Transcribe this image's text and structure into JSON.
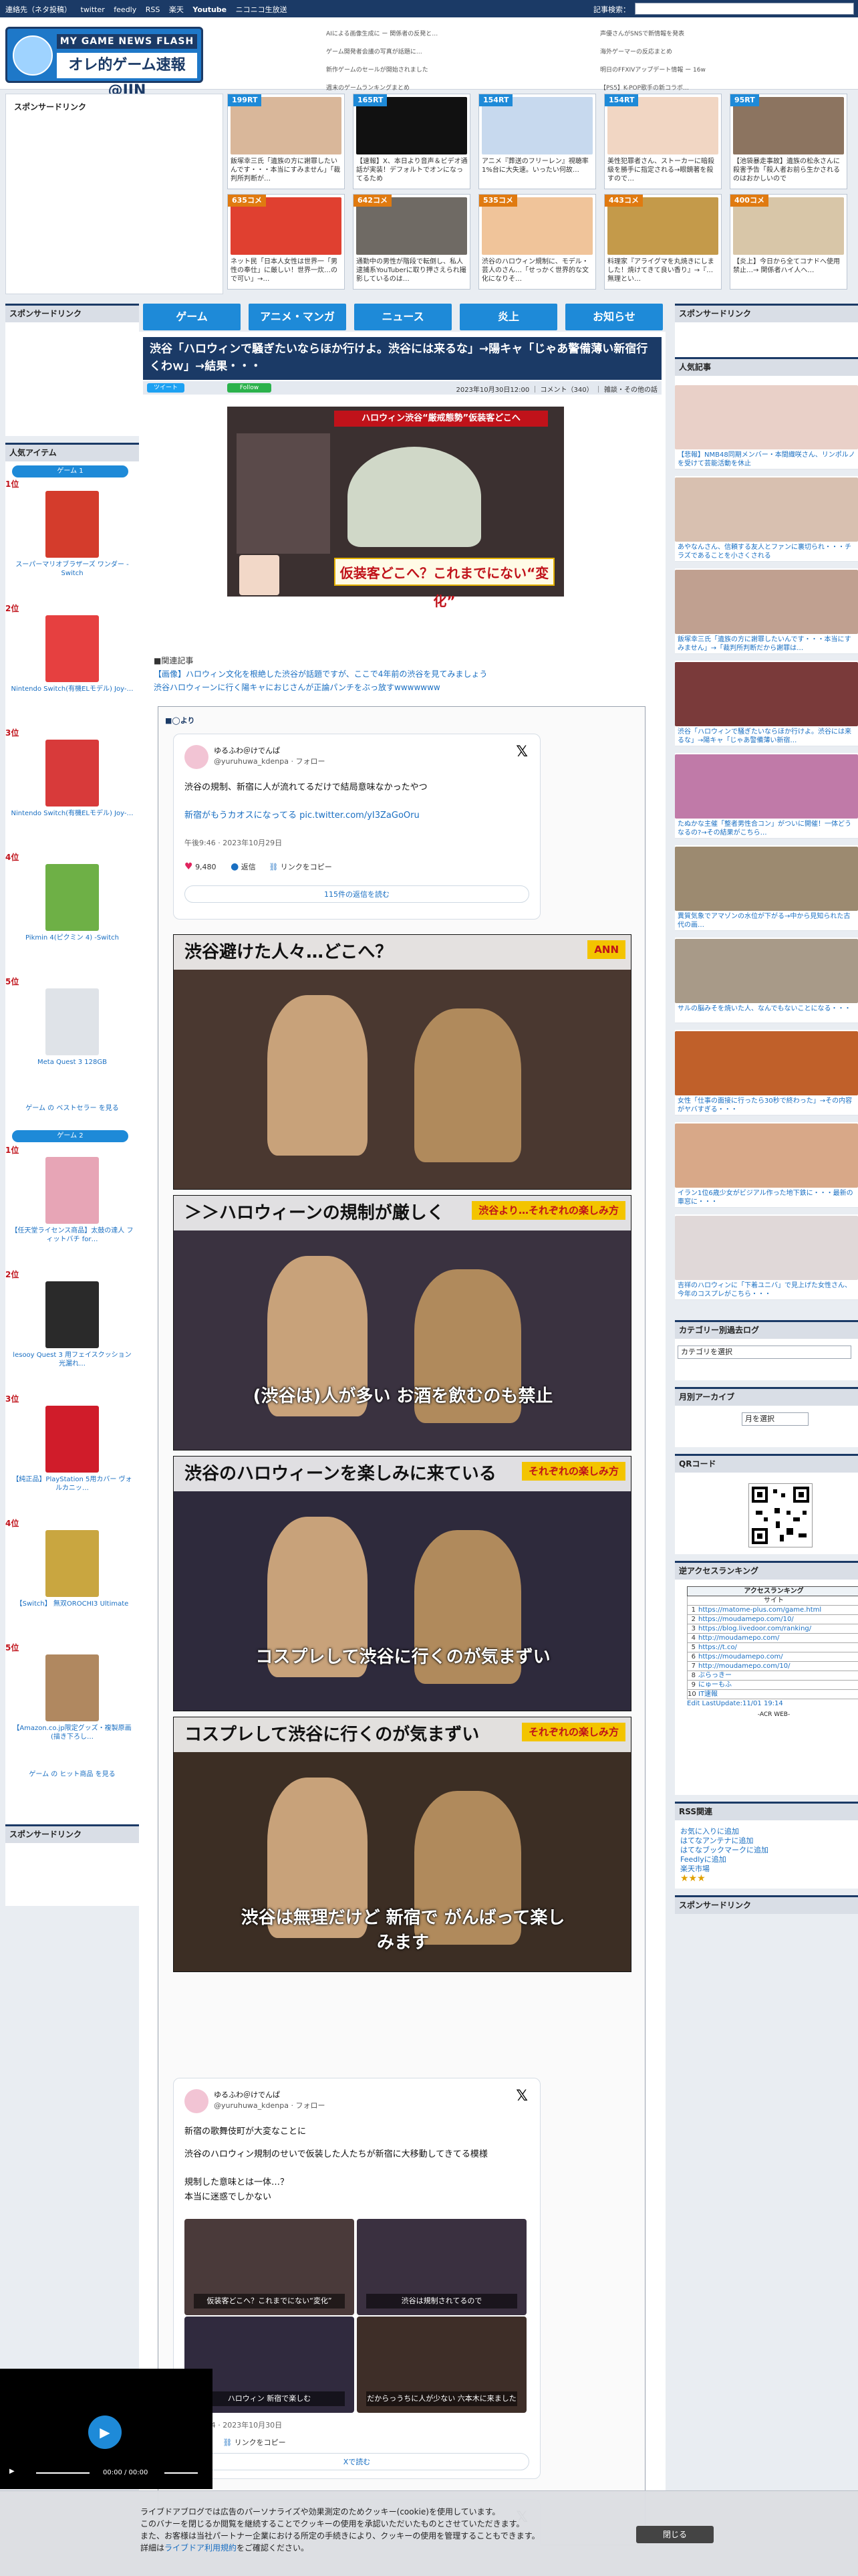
{
  "topbar": {
    "links": [
      "連絡先（ネタ投稿）",
      "twitter",
      "feedly",
      "RSS",
      "楽天",
      "Youtube",
      "ニコニコ生放送"
    ],
    "search_label": "記事検索："
  },
  "logo": {
    "top": "MY GAME NEWS FLASH",
    "main": "オレ的ゲーム速報@JIN"
  },
  "header_links_a": [
    "AIによる画像生成に ー 関係者の反発と…",
    "ゲーム開発者会議の写真が話題に…",
    "新作ゲームのセールが開始されました",
    "週末のゲームランキングまとめ"
  ],
  "header_links_b": [
    "声優さんがSNSで新情報を発表",
    "海外ゲーマーの反応まとめ",
    "明日のFFXIVアップデート情報 ー 16w",
    "【PS5】K-POP歌手の新コラボ…"
  ],
  "sponsor_label": "スポンサードリンク",
  "banners": [
    {
      "badge": "199RT",
      "badge_color": "#1e8ad8",
      "thumb": "#d9b79a",
      "caption": "飯塚幸三氏「遺族の方に謝罪したいんです・・・本当にすみません」「裁判所判断が…"
    },
    {
      "badge": "165RT",
      "badge_color": "#1e8ad8",
      "thumb": "#111111",
      "caption": "【速報】X、本日より音声＆ビデオ通話が実装！デフォルトでオンになってるため"
    },
    {
      "badge": "154RT",
      "badge_color": "#1e8ad8",
      "thumb": "#c7d9ee",
      "caption": "アニメ『葬送のフリーレン』視聴率1%台に大失速。いったい何故…"
    },
    {
      "badge": "154RT",
      "badge_color": "#1e8ad8",
      "thumb": "#f1d6c3",
      "caption": "美性犯罪者さん、ストーカーに暗殺級を勝手に指定される→眼鏡著を殺すので…"
    },
    {
      "badge": "95RT",
      "badge_color": "#1e8ad8",
      "thumb": "#8c7460",
      "caption": "【池袋暴走事故】遺族の松永さんに殺害予告「殺人者お前ら生かされるのはおかしいので"
    },
    {
      "badge": "635コメ",
      "badge_color": "#e07a10",
      "thumb": "#e04030",
      "caption": "ネット民「日本人女性は世界一「男性の奉仕」に厳しい！世界一炊…ので可い」→…"
    },
    {
      "badge": "642コメ",
      "badge_color": "#e07a10",
      "thumb": "#6f6a64",
      "caption": "通勤中の男性が階段で転倒し、私人逮捕系YouTuberに取り押さえられ撮影しているのは…"
    },
    {
      "badge": "535コメ",
      "badge_color": "#e07a10",
      "thumb": "#f0c49a",
      "caption": "渋谷のハロウィン規制に、モデル・芸人のさん…「せっかく世界的な文化になりそ…"
    },
    {
      "badge": "443コメ",
      "badge_color": "#e07a10",
      "thumb": "#c49a4a",
      "caption": "料理家『アライグマを丸焼きにしました！焼けてきて良い香り』→『…無理とい…"
    },
    {
      "badge": "400コメ",
      "badge_color": "#e07a10",
      "thumb": "#d8c6a8",
      "caption": "【炎上】今日から全てコナドへ使用禁止…→ 関係者ハイ人へ…"
    }
  ],
  "nav": [
    "ゲーム",
    "アニメ・マンガ",
    "ニュース",
    "炎上",
    "お知らせ"
  ],
  "article": {
    "title": "渋谷「ハロウィンで騒ぎたいならほか行けよ。渋谷には来るな」→陽キャ「じゃあ警備薄い新宿行くわｗ」→結果・・・",
    "tweet_btn": "ツイート",
    "follow_btn": "Follow",
    "meta": "2023年10月30日12:00 ｜ コメント（340） ｜ 雑談・その他の話",
    "hero_tag": "ハロウィン渋谷“厳戒態勢”仮装客どこへ",
    "hero_caption": "仮装客どこへ？これまでにない“変化”",
    "related_label": "■関連記事",
    "related_links": [
      "【画像】ハロウィン文化を根絶した渋谷が話題ですが、ここで4年前の渋谷を見てみましょう",
      "渋谷ハロウィーンに行く陽キャにおじさんが正論パンチをぶっ放すwwwwwww"
    ],
    "quote_head": "■◯より"
  },
  "tweet1": {
    "uname": "ゆるふわ＠けでんぱ",
    "handle": "@yuruhuwa_kdenpa · フォロー",
    "text1": "渋谷の規制、新宿に人が流れてるだけで結局意味なかったやつ",
    "text2": "新宿がもうカオスになってる pic.twitter.com/yI3ZaGoOru",
    "time": "午後9:46 · 2023年10月29日",
    "likes": "9,480",
    "reply": "返信",
    "copy": "リンクをコピー",
    "more": "115件の返信を読む"
  },
  "photos": [
    {
      "top": "渋谷避けた人々…どこへ？",
      "tag": "ANN",
      "bottom": "",
      "bg": "#4a3830"
    },
    {
      "top": "＞＞ハロウィーンの規制が厳しく",
      "tag": "渋谷より…それぞれの楽しみ方",
      "bottom": "(渋谷は)人が多い お酒を飲むのも禁止",
      "bg": "#3a3240"
    },
    {
      "top": "渋谷のハロウィーンを楽しみに来ている",
      "tag": "それぞれの楽しみ方",
      "bottom": "コスプレして渋谷に行くのが気まずい",
      "bg": "#2e2a3c"
    },
    {
      "top": "コスプレして渋谷に行くのが気まずい",
      "tag": "それぞれの楽しみ方",
      "bottom": "渋谷は無理だけど 新宿で がんばって楽しみます",
      "bg": "#3c2e24"
    }
  ],
  "tweet2": {
    "uname": "ゆるふわ＠けでんぱ",
    "handle": "@yuruhuwa_kdenpa · フォロー",
    "text1": "新宿の歌舞伎町が大変なことに",
    "text2": "渋谷のハロウィン規制のせいで仮装した人たちが新宿に大移動してきてる模様",
    "text3": "規制した意味とは一体…？",
    "text4": "本当に迷惑でしかない",
    "mini_caps": [
      "仮装客どこへ？これまでにない“変化”",
      "渋谷は規制されてるので",
      "ハロウィン 新宿で楽しむ",
      "だからっうちに人が少ない 六本木に来ました"
    ],
    "time": "午後0:54 · 2023年10月30日",
    "reply": "返信",
    "copy": "リンクをコピー",
    "more": "Xで読む"
  },
  "left_col": {
    "popular_title": "人気アイテム",
    "tab1": "ゲーム 1",
    "tab2": "ゲーム 2",
    "items1": [
      {
        "rank": "1位",
        "name": "スーパーマリオブラザーズ ワンダー - Switch",
        "color": "#d43c2c"
      },
      {
        "rank": "2位",
        "name": "Nintendo Switch(有機ELモデル) Joy-…",
        "color": "#e64040"
      },
      {
        "rank": "3位",
        "name": "Nintendo Switch(有機ELモデル) Joy-…",
        "color": "#d83a3a"
      },
      {
        "rank": "4位",
        "name": "Pikmin 4(ピクミン 4) -Switch",
        "color": "#6eb046"
      },
      {
        "rank": "5位",
        "name": "Meta Quest 3 128GB",
        "color": "#dfe3e8"
      }
    ],
    "see1": "ゲーム の ベストセラー を見る",
    "items2": [
      {
        "rank": "1位",
        "name": "【任天堂ライセンス商品】太鼓の達人 フィットバチ for…",
        "color": "#e7a5b6"
      },
      {
        "rank": "2位",
        "name": "lesooy Quest 3 用フェイスクッション 光漏れ…",
        "color": "#2a2a2a"
      },
      {
        "rank": "3位",
        "name": "【純正品】PlayStation 5用カバー ヴォルカニッ…",
        "color": "#d01c2a"
      },
      {
        "rank": "4位",
        "name": "【Switch】 無双OROCHI3 Ultimate",
        "color": "#c9a640"
      },
      {
        "rank": "5位",
        "name": "【Amazon.co.jp限定グッズ・複製原画(描き下ろし…",
        "color": "#b08860"
      }
    ],
    "see2": "ゲーム の ヒット商品 を見る",
    "sponsor2": "スポンサードリンク",
    "sponsor3": "スポンサードリンク"
  },
  "right_col": {
    "sponsor": "スポンサードリンク",
    "popular_title": "人気記事",
    "popular": [
      {
        "text": "【悲報】NMB48同期メンバー・本間織咲さん、リンポルノを受けて芸能活動を休止",
        "color": "#e9d0c8"
      },
      {
        "text": "あやなんさん、信頼する友人とファンに裏切られ・・・チラズであることを小さくされる",
        "color": "#d8c0b0"
      },
      {
        "text": "飯塚幸三氏「遺族の方に謝罪したいんです・・・本当にすみません」→「裁判所判断だから謝罪は…",
        "color": "#c0a090"
      },
      {
        "text": "渋谷「ハロウィンで騒ぎたいならほか行けよ。渋谷には来るな」→陽キャ「じゃあ警備薄い新宿…",
        "color": "#7a3a3a"
      },
      {
        "text": "たぬかな主催「整者男性合コン」がついに開催！一体どうなるの?→その結果がこちら…",
        "color": "#c07aa8"
      },
      {
        "text": "異質気象でアマゾンの水位が下がる→中から見知られた古代の画…",
        "color": "#9c8a70"
      },
      {
        "text": "サルの脳みそを焼いた人、なんでもないことになる・・・",
        "color": "#a89a88"
      },
      {
        "text": "女性「仕事の面接に行ったら30秒で終わった」→その内容がヤバすぎる・・・",
        "color": "#c0602a"
      },
      {
        "text": "イラン1位6歳少女がビジアル作った地下鉄に・・・最新の車窓に・・・",
        "color": "#d8a888"
      },
      {
        "text": "吉祥のハロウィンに「下着ユニバ」で見上げた女性さん、今年のコスプレがこちら・・・",
        "color": "#e0d8d8"
      }
    ],
    "cat_title": "カテゴリー別過去ログ",
    "cat_select": "カテゴリを選択",
    "month_title": "月別アーカイブ",
    "month_select": "月を選択",
    "qr_title": "QRコード",
    "access_title": "逆アクセスランキング",
    "access_head": "アクセスランキング",
    "access_sub": "サイト",
    "access_rows": [
      {
        "n": "1",
        "t": "https://matome-plus.com/game.html"
      },
      {
        "n": "2",
        "t": "https://moudamepo.com/10/"
      },
      {
        "n": "3",
        "t": "https://blog.livedoor.com/ranking/"
      },
      {
        "n": "4",
        "t": "http://moudamepo.com/"
      },
      {
        "n": "5",
        "t": "https://t.co/"
      },
      {
        "n": "6",
        "t": "https://moudamepo.com/"
      },
      {
        "n": "7",
        "t": "http://moudamepo.com/10/"
      },
      {
        "n": "8",
        "t": "ぶらっきー"
      },
      {
        "n": "9",
        "t": "にゅーもふ"
      },
      {
        "n": "10",
        "t": "IT速報"
      }
    ],
    "access_footer": "Edit LastUpdate:11/01 19:14",
    "access_brand": "-ACR WEB-",
    "rss_title": "RSS関連",
    "rss_links": [
      "お気に入りに追加",
      "はてなアンテナに追加",
      "はてなブックマークに追加",
      "Feedlyに追加",
      "楽天市場"
    ],
    "sponsor2": "スポンサードリンク"
  },
  "player": {
    "time": "00:00 / 00:00"
  },
  "cookie": {
    "line1": "ライブドアブログでは広告のパーソナライズや効果測定のためクッキー(cookie)を使用しています。",
    "line2": "このバナーを閉じるか閲覧を継続することでクッキーの使用を承認いただいたものとさせていただきます。",
    "line3": "また、お客様は当社パートナー企業における所定の手続きにより、クッキーの使用を管理することもできます。",
    "line4_pre": "詳細は",
    "line4_link": "ライブドア利用規約",
    "line4_post": "をご確認ください。",
    "close": "閉じる"
  }
}
